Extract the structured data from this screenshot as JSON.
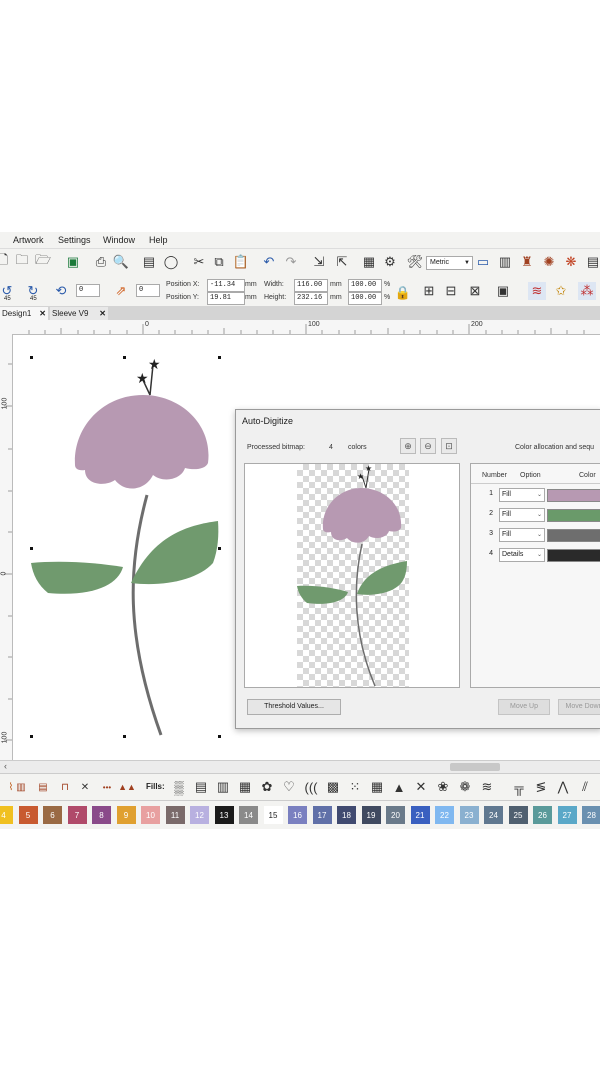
{
  "menu": {
    "items": [
      "Artwork",
      "Settings",
      "Window",
      "Help"
    ]
  },
  "toolbar": {
    "position_x_label": "Position X:",
    "position_y_label": "Position Y:",
    "position_x": "-11.34",
    "position_y": "19.81",
    "width_label": "Width:",
    "height_label": "Height:",
    "width": "116.00",
    "height": "232.16",
    "scale_w": "100.00",
    "scale_h": "100.00",
    "unit_mm": "mm",
    "unit_pct": "%",
    "units_select": "Metric",
    "rotate_45": "45",
    "angle_value": "0",
    "slant_value": "0"
  },
  "tabs": [
    "Design1",
    "Sleeve V9"
  ],
  "ruler": {
    "h_labels": [
      "0",
      "100",
      "200"
    ],
    "v_labels": [
      "100",
      "0",
      "100"
    ]
  },
  "stitch_bar": {
    "fills_label": "Fills:"
  },
  "palette": {
    "colors": [
      {
        "num": "4",
        "hex": "#f0c020"
      },
      {
        "num": "5",
        "hex": "#c85a30"
      },
      {
        "num": "6",
        "hex": "#9a6a44"
      },
      {
        "num": "7",
        "hex": "#b04a6a"
      },
      {
        "num": "8",
        "hex": "#8a4a8a"
      },
      {
        "num": "9",
        "hex": "#e0a030"
      },
      {
        "num": "10",
        "hex": "#e8a0a0"
      },
      {
        "num": "11",
        "hex": "#7a6a6a"
      },
      {
        "num": "12",
        "hex": "#b8b0e0"
      },
      {
        "num": "13",
        "hex": "#1a1a1a"
      },
      {
        "num": "14",
        "hex": "#8a8a8a"
      },
      {
        "num": "15",
        "hex": "#ffffff"
      },
      {
        "num": "16",
        "hex": "#7a80c0"
      },
      {
        "num": "17",
        "hex": "#6070a8"
      },
      {
        "num": "18",
        "hex": "#404a70"
      },
      {
        "num": "19",
        "hex": "#404a60"
      },
      {
        "num": "20",
        "hex": "#6a7a8a"
      },
      {
        "num": "21",
        "hex": "#3a60c0"
      },
      {
        "num": "22",
        "hex": "#80b8f0"
      },
      {
        "num": "23",
        "hex": "#8ab0d0"
      },
      {
        "num": "24",
        "hex": "#607890"
      },
      {
        "num": "25",
        "hex": "#506070"
      },
      {
        "num": "26",
        "hex": "#5a9a9a"
      },
      {
        "num": "27",
        "hex": "#5aa8c8"
      },
      {
        "num": "28",
        "hex": "#6a90b0"
      }
    ]
  },
  "dialog": {
    "title": "Auto-Digitize",
    "processed_label": "Processed bitmap:",
    "colors_count": "4",
    "colors_label": "colors",
    "right_heading": "Color allocation and sequ",
    "col_number": "Number",
    "col_option": "Option",
    "col_color": "Color",
    "rows": [
      {
        "num": "1",
        "option": "Fill",
        "hex": "#b799b2"
      },
      {
        "num": "2",
        "option": "Fill",
        "hex": "#6a9a6a"
      },
      {
        "num": "3",
        "option": "Fill",
        "hex": "#6e6e6e"
      },
      {
        "num": "4",
        "option": "Details",
        "hex": "#2a2a2a"
      }
    ],
    "threshold_btn": "Threshold Values...",
    "move_up_btn": "Move Up",
    "move_down_btn": "Move Down"
  },
  "colors": {
    "petal": "#b799b2",
    "leaf": "#709a6e",
    "stem": "#6d6d6d",
    "accent": "#444444"
  }
}
